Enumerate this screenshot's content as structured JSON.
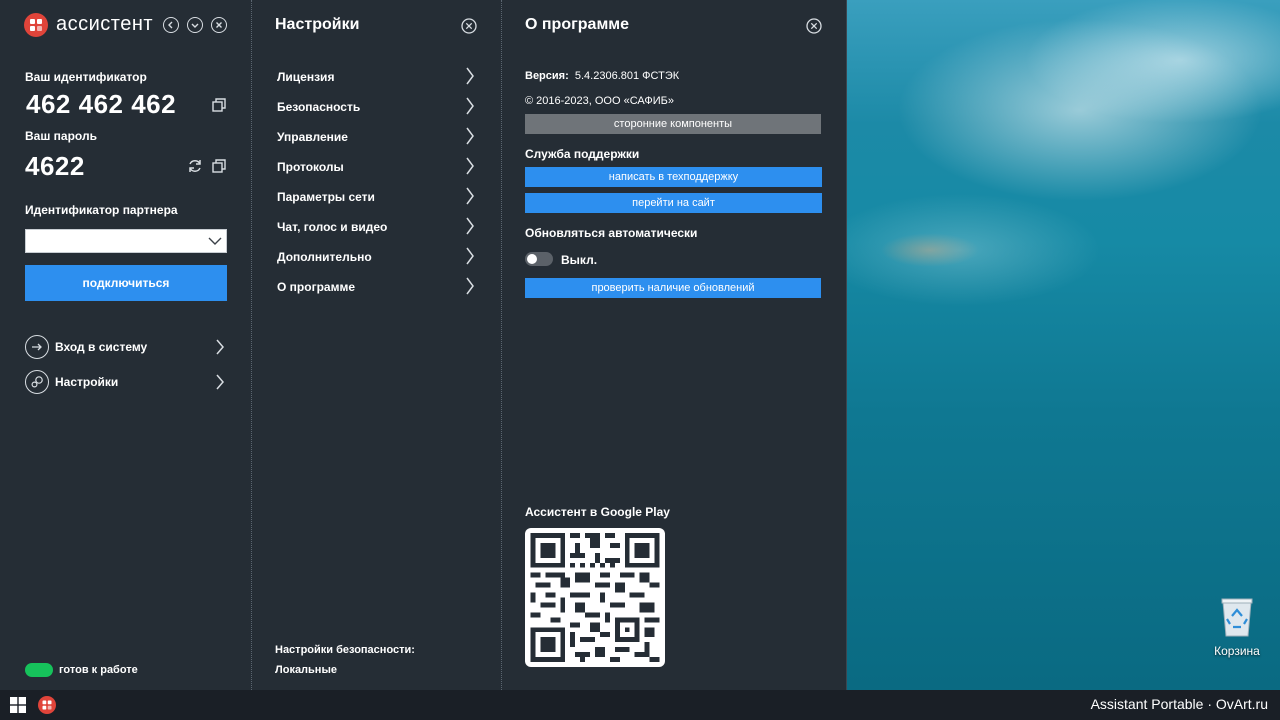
{
  "desktop": {
    "recycle_bin_label": "Корзина"
  },
  "left_panel": {
    "app_title": "ассистент",
    "id_label": "Ваш идентификатор",
    "id_value": "462 462 462",
    "password_label": "Ваш пароль",
    "password_value": "4622",
    "partner_label": "Идентификатор партнера",
    "partner_input_value": "",
    "connect_label": "подключиться",
    "menu": [
      {
        "label": "Вход в систему",
        "icon": "login-icon"
      },
      {
        "label": "Настройки",
        "icon": "gears-icon"
      }
    ],
    "status_text": "готов к работе",
    "status_color": "#16c25b"
  },
  "settings_panel": {
    "title": "Настройки",
    "items": [
      {
        "label": "Лицензия"
      },
      {
        "label": "Безопасность"
      },
      {
        "label": "Управление"
      },
      {
        "label": "Протоколы"
      },
      {
        "label": "Параметры сети"
      },
      {
        "label": "Чат, голос и видео"
      },
      {
        "label": "Дополнительно"
      },
      {
        "label": "О программе"
      }
    ],
    "security_settings_label": "Настройки безопасности:",
    "security_settings_value": "Локальные"
  },
  "about_panel": {
    "title": "О программе",
    "version_label": "Версия:",
    "version_value": "5.4.2306.801 ФСТЭК",
    "copyright": "© 2016-2023, ООО «САФИБ»",
    "third_party_button": "сторонние компоненты",
    "support_title": "Служба поддержки",
    "write_support_button": "написать в техподдержку",
    "go_site_button": "перейти на сайт",
    "auto_update_title": "Обновляться автоматически",
    "auto_update_state": "Выкл.",
    "check_updates_button": "проверить наличие обновлений",
    "google_play_label": "Ассистент в Google Play"
  },
  "taskbar": {
    "watermark": "Assistant Portable · OvArt.ru"
  },
  "colors": {
    "panel_bg": "#252d35",
    "accent_blue": "#2d8fef",
    "gray_button": "#6f7479",
    "logo_red": "#e0443a"
  }
}
